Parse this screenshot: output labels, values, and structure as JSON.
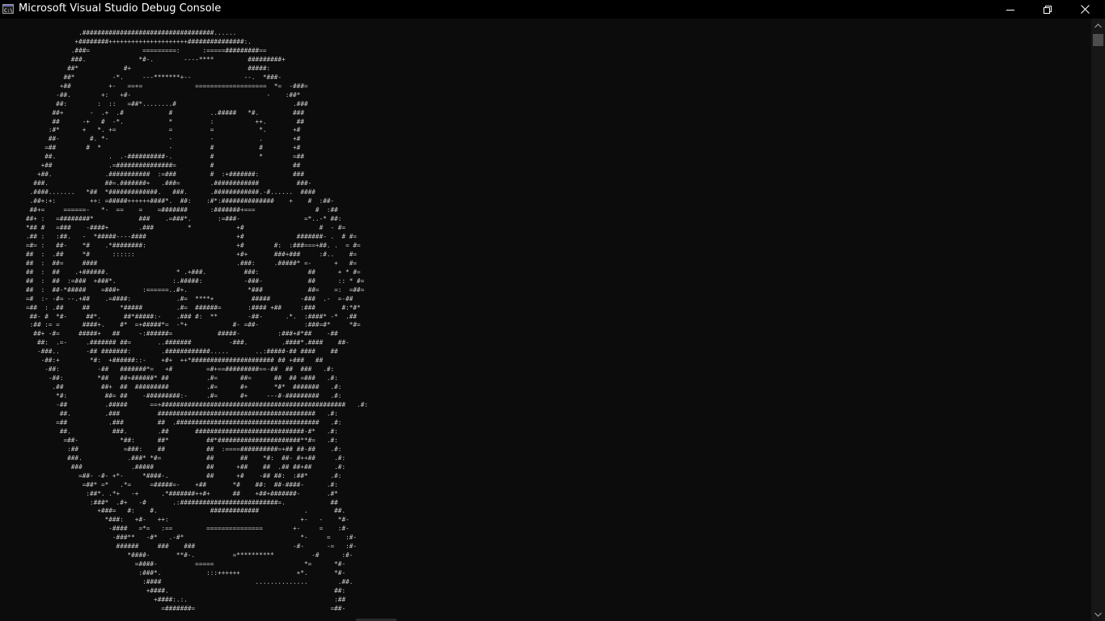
{
  "window": {
    "title": "Microsoft Visual Studio Debug Console",
    "icon": "console-app-icon",
    "controls": {
      "minimize": "minimize-icon",
      "maximize": "restore-icon",
      "close": "close-icon"
    }
  },
  "console": {
    "foreground": "#cccccc",
    "background": "#0c0c0c",
    "output": "              .###################################......\n             +########+++++++++++++++++++++###############:.\n            .###=              =========:      :=====#########==\n            ###.              *#-.        ----****         #########+\n           ##*            #+                               #####:\n          ##*          -*.     ---*******+--              --.  *###-\n         +##          +-   ==+=              ===================  *=  -###=\n        -##.        +:   +#-                                    -    :##*\n        ##:        :  ::   =##*........#                               .###\n       ##+       -  .+  .#            #          ..#####   *#.         ###\n       ##      -+   #  -*.            *          :           ++.        ##\n      :#*      +   *. +=              =          =            *.       +#\n      ##-        #. *-                -          -            .        +#\n     =##        #  *                  -          #            #        +#\n     ##.              .  .-##########-.          #            *        =##\n    +##               .=###############=         #                     ##\n   +##.              .###########  :=###         #  :+#######:         ###\n  ###.               ##=.#######+   .###=        .############          ###-\n .####.......   *##  *#############.   ###.      .############.-#......  ####\n .##+:+:         ++: =#####++++++####*.  ##:    :#*:##############    +    #  :##-\n ##+=     ======-   *-  ==    =    =#######      :#######+===                #  :##\n##+ :   =########*            ###    .=###*.       :=###-                 =*..-* ##:\n*## #   =###    -####+        .###         *            +#                    #  - #=\n.## :   :##.   -  *#####----####                        +#              #######- .  # #=\n=#= :   ##-    *#    .*########:                        +#        #:  :###===+##. .  = #=\n##  :  .##     *#      ::::::                           +#+       ###+###     :#..    #=\n##  :  ##=     ####                                     .###:     .#####* =-      +   #=\n##  :  ##    .+######.                  * .+###.          ###:             ##      + * #=\n##  :  ##  :=###  +###*.               :.#####:           -###-            ##      :: * #=\n##  :  ##-*#####    =###+      :======..#+.                *###            ##=    =:  =##=\n=#  :- -#= --.+##    .=####:            .#=  ****+          #####        -###  .-  =-##\n=##  : .##     ##        *#####         .#=  ######=       :#### +##     :###       #:*#*\n ##- #  *#-     ##*.      ##*#####:-    .### #:  **        -##-      .*.  :####* -*  .##\n :## := =      ####+.    #*  =+#####*=  -*+            #- =##-            :###=#*     *#=\n  ##+ -#=     #####+   ##     -:######=            #####-          :###+#*##    -##\n   ##:  .=-     .####### ##=       ..#######          -###.         .####*.####    ##-\n   -###..       -## #######:        .############.....       ..:#####-## ####    ##\n    -##:+        *#:  +######::-    +#+  ++*###################### ## +###   ##\n     -##:          -##   #######*=   +#         =#+==#########==-##  ##  ###   .#:\n      -##:         *##   ##+######* ##          .#=      ##=      ##  ## =###   .#:\n       .##          ##+  ##  #########          .#=      #+       *#*  #######   .#:\n        *#:          ##= ##    -#########:-     .#=      #+     ---#-#########   .#:\n        -##          .#####      ==+#################################################   .#:\n         ##.         .###          ##########################################   .#:\n        =##           .###         ##  .######################################   .#:\n         ##.           ###.        .##       #############################-#*   .#:\n          =##-           *##:      ##*          ##*######################**#=   .#:\n           :##            =###:    ##           ##  :====##########=+## ##-##    .#:\n           ###.            .###* *#=            ##       ##    *#:  ##- #++##     .#:\n            ###             .#####              ##      +##    ##  .## ##+##      .#:\n              =##- -#- +*-     *####-.          ##      +#    -## ##:  :##*      .#:\n               =##* =*   .*=     =#####=-    +##       *#    ##:  ##-####-      .#:\n                :##*. .*+   -+      .*#######++#+      ##    +##+#######-       .#*\n                 :###*  .#+   -#       .:##########################=.            ##\n                   +###=   #:    #.              #############            .       ##.\n                     *###:   +#-   ++:                                   +-   -    *#-\n                      -####   =*=   :==         ===============        +-     =    :#-\n                       -###**   -#*   .-#*                               *-     =    :#-\n                        ######     ###    ###                          -#-      -=   :#-\n                           *####-       **#-.          =**********          -#      :#-\n                             =####-          =====                        *=      *#-\n                              :###*.            :::++++++               +*.       *#-\n                               :####                         ..............        .##.\n                                +####.                                            ##:\n                                  +####:.:.                                       :##\n                                    =#######=                                    =##-"
  },
  "scrollbar": {
    "up_arrow": "chevron-up-icon",
    "down_arrow": "chevron-down-icon"
  }
}
